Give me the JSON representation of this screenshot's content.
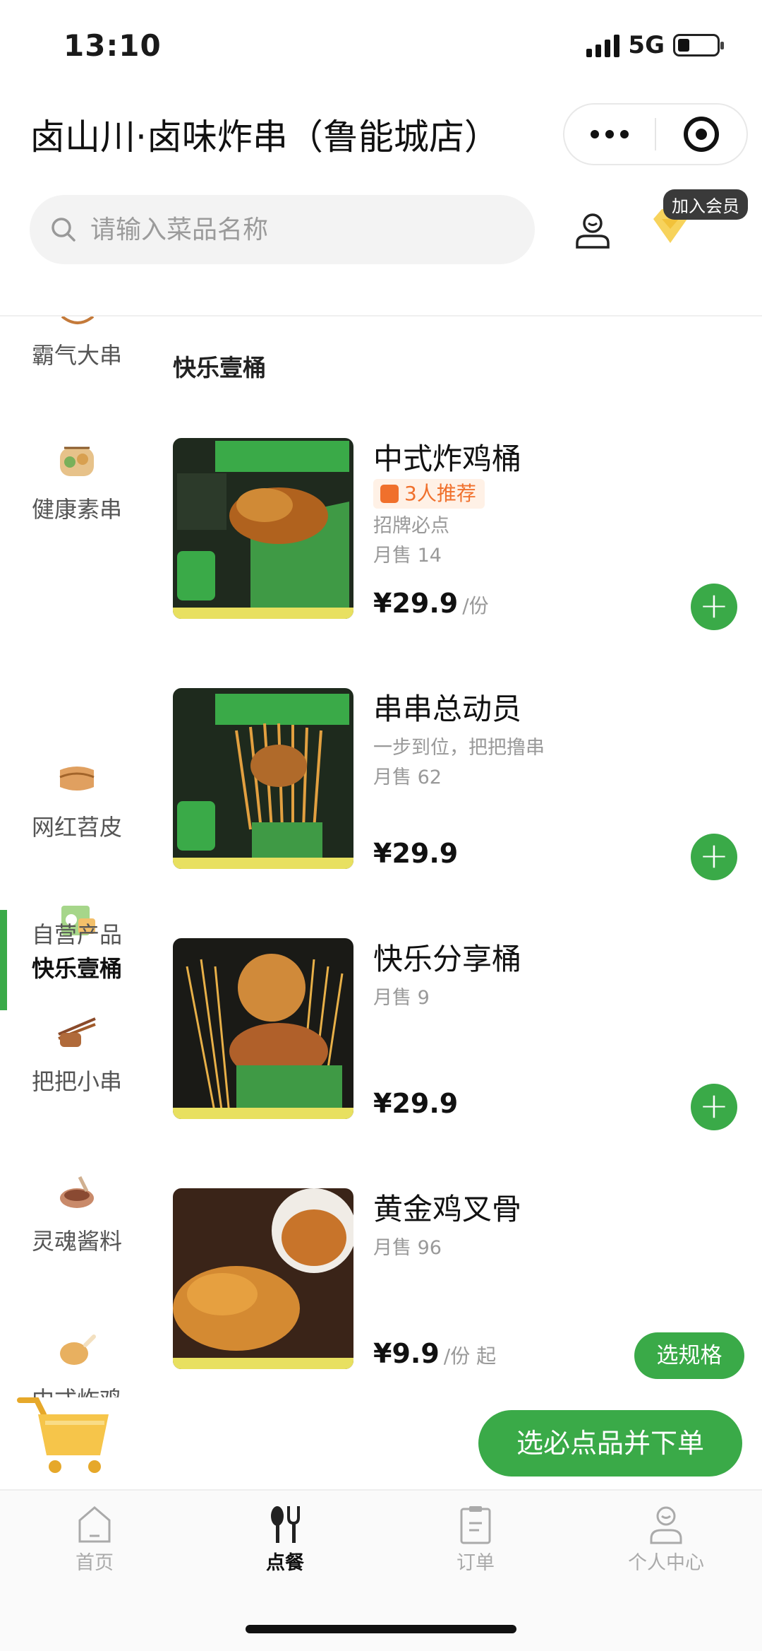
{
  "status_bar": {
    "time": "13:10",
    "network": "5G"
  },
  "header": {
    "store_title": "卤山川·卤味炸串（鲁能城店）"
  },
  "search": {
    "placeholder": "请输入菜品名称"
  },
  "membership": {
    "join_label": "加入会员"
  },
  "sidebar": {
    "items": [
      {
        "label": "霸气大串",
        "icon": "skewer-icon"
      },
      {
        "label": "健康素串",
        "icon": "vegetable-skewer-icon"
      },
      {
        "label": "快乐壹桶",
        "icon": "bucket-icon",
        "active": true
      },
      {
        "label": "网红苕皮",
        "icon": "sheet-icon"
      },
      {
        "label": "自营产品",
        "icon": ""
      },
      {
        "label": "把把小串",
        "icon": "bundle-skewer-icon"
      },
      {
        "label": "灵魂酱料",
        "icon": "sauce-icon"
      },
      {
        "label": "中式炸鸡",
        "icon": "chicken-leg-icon"
      }
    ]
  },
  "section": {
    "title": "快乐壹桶"
  },
  "products": [
    {
      "name": "中式炸鸡桶",
      "tag": "3人推荐",
      "desc": "招牌必点",
      "sales": "月售 14",
      "price": "¥29.9",
      "unit": "/份",
      "action": "+"
    },
    {
      "name": "串串总动员",
      "desc": "一步到位，把把撸串",
      "sales": "月售 62",
      "price": "¥29.9",
      "unit": "",
      "action": "+"
    },
    {
      "name": "快乐分享桶",
      "sales": "月售 9",
      "price": "¥29.9",
      "unit": "",
      "action": "+"
    },
    {
      "name": "黄金鸡叉骨",
      "sales": "月售 96",
      "price": "¥9.9",
      "unit": "/份 起",
      "action": "选规格"
    }
  ],
  "cart": {
    "checkout_label": "选必点品并下单"
  },
  "tabbar": {
    "tabs": [
      {
        "label": "首页"
      },
      {
        "label": "点餐",
        "active": true
      },
      {
        "label": "订单"
      },
      {
        "label": "个人中心"
      }
    ]
  },
  "colors": {
    "accent": "#3aaa48",
    "tag_orange": "#f0702c",
    "text_gray": "#999999"
  }
}
